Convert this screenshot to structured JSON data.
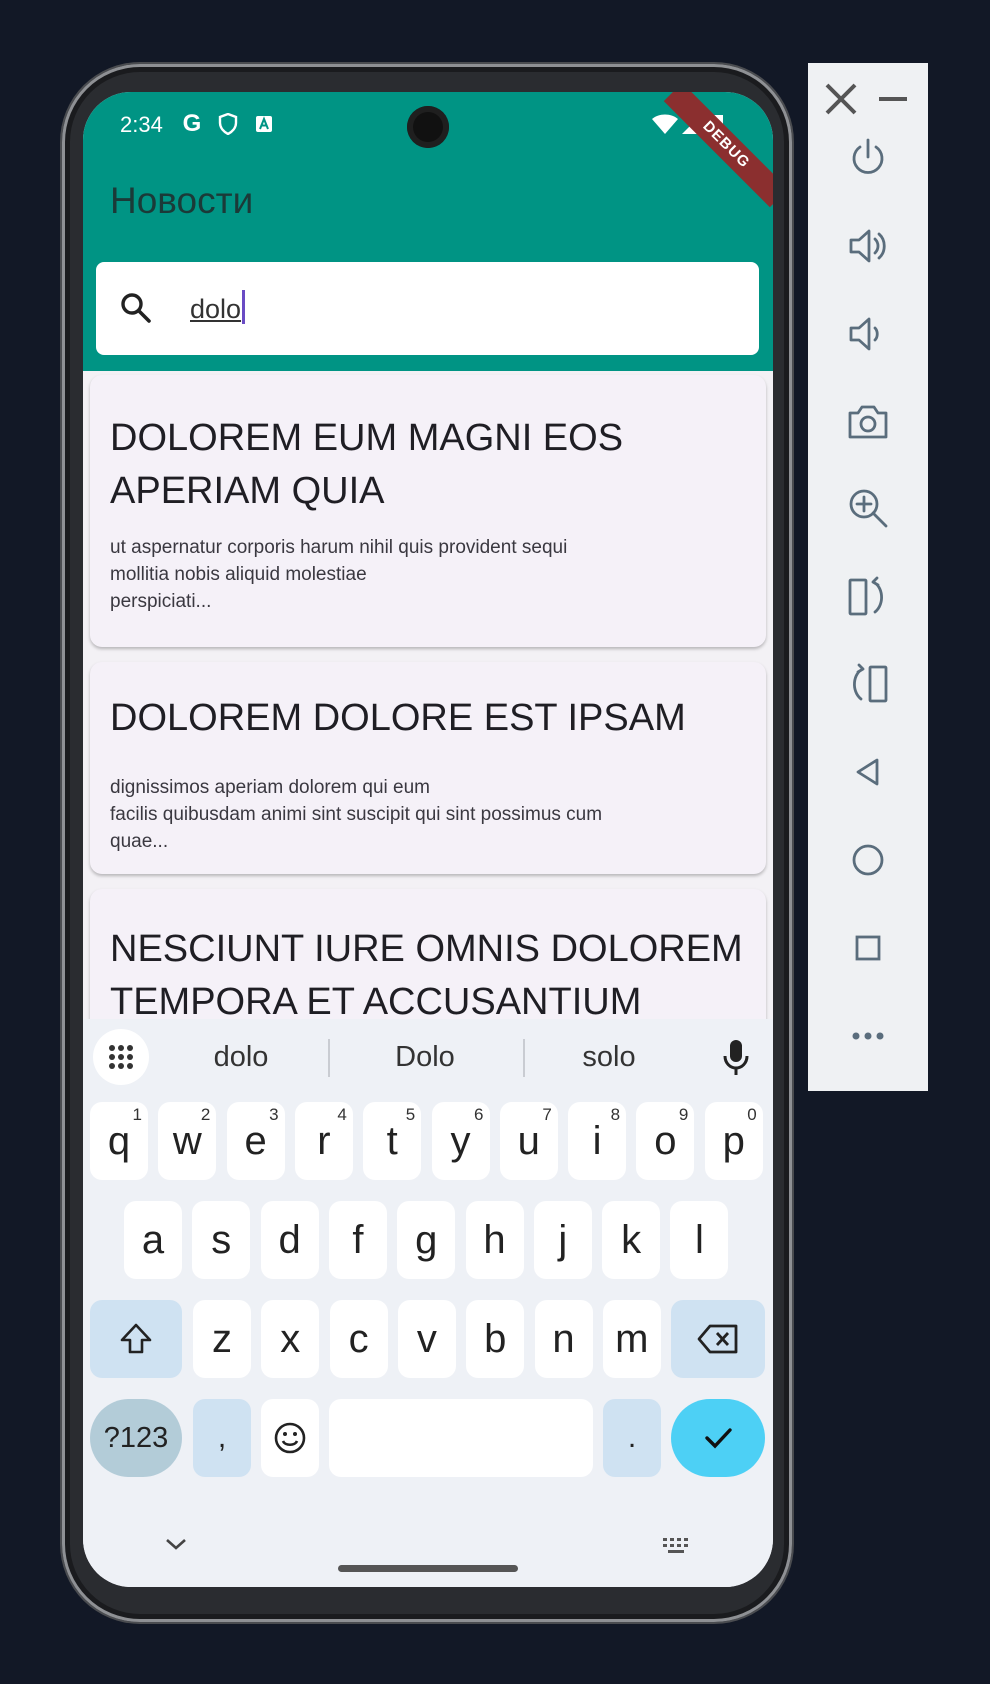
{
  "status_bar": {
    "time": "2:34",
    "debug_label": "DEBUG"
  },
  "app": {
    "title": "Новости"
  },
  "search": {
    "query": "dolo"
  },
  "articles": [
    {
      "title": "DOLOREM EUM MAGNI EOS APERIAM QUIA",
      "body": "ut aspernatur corporis harum nihil quis provident sequi\nmollitia nobis aliquid molestiae\nperspiciati..."
    },
    {
      "title": "DOLOREM DOLORE EST IPSAM",
      "body": "dignissimos aperiam dolorem qui eum\nfacilis quibusdam animi sint suscipit qui sint possimus cum\nquae..."
    },
    {
      "title": "NESCIUNT IURE OMNIS DOLOREM TEMPORA ET ACCUSANTIUM",
      "body": ""
    }
  ],
  "keyboard": {
    "suggestions": [
      "dolo",
      "Dolo",
      "solo"
    ],
    "row1": [
      {
        "k": "q",
        "n": "1"
      },
      {
        "k": "w",
        "n": "2"
      },
      {
        "k": "e",
        "n": "3"
      },
      {
        "k": "r",
        "n": "4"
      },
      {
        "k": "t",
        "n": "5"
      },
      {
        "k": "y",
        "n": "6"
      },
      {
        "k": "u",
        "n": "7"
      },
      {
        "k": "i",
        "n": "8"
      },
      {
        "k": "o",
        "n": "9"
      },
      {
        "k": "p",
        "n": "0"
      }
    ],
    "row2": [
      "a",
      "s",
      "d",
      "f",
      "g",
      "h",
      "j",
      "k",
      "l"
    ],
    "row3": [
      "z",
      "x",
      "c",
      "v",
      "b",
      "n",
      "m"
    ],
    "symbols_key": "?123",
    "comma_key": ",",
    "period_key": "."
  },
  "colors": {
    "appbar": "#009484",
    "accent": "#4dd0f5",
    "caret": "#6a4bc4"
  },
  "side_panel": {
    "icons": [
      "close-icon",
      "minimize-icon",
      "power-icon",
      "volume-up-icon",
      "volume-down-icon",
      "camera-icon",
      "zoom-in-icon",
      "rotate-right-icon",
      "rotate-left-icon",
      "back-icon",
      "home-icon",
      "overview-icon",
      "more-icon"
    ]
  }
}
